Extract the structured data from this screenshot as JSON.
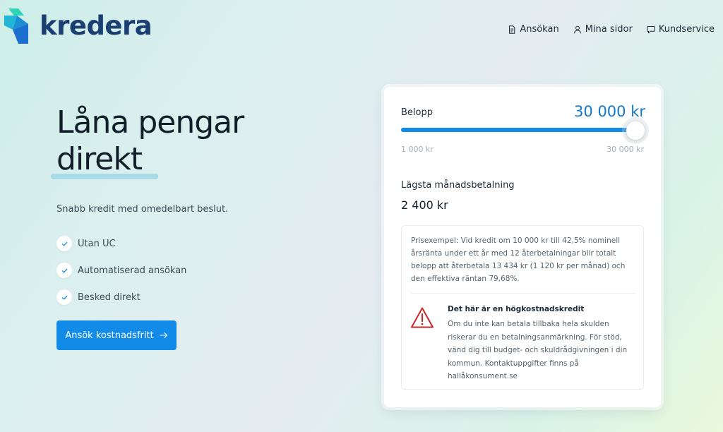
{
  "brand": {
    "name": "kredera"
  },
  "nav": [
    {
      "label": "Ansökan",
      "icon": "document-icon"
    },
    {
      "label": "Mina sidor",
      "icon": "user-icon"
    },
    {
      "label": "Kundservice",
      "icon": "chat-icon"
    }
  ],
  "hero": {
    "title_line1": "Låna pengar",
    "title_line2": "direkt",
    "subtitle": "Snabb kredit med omedelbart beslut.",
    "features": [
      "Utan UC",
      "Automatiserad ansökan",
      "Besked direkt"
    ],
    "cta_label": "Ansök kostnadsfritt"
  },
  "calculator": {
    "amount_label": "Belopp",
    "amount_value": "30 000 kr",
    "slider_min": "1 000 kr",
    "slider_max": "30 000 kr",
    "slider_fraction": 1.0,
    "lowest_payment_label": "Lägsta månadsbetalning",
    "lowest_payment_value": "2 400 kr",
    "price_example": "Prisexempel: Vid kredit om 10 000 kr till 42,5% nominell årsränta under ett år med 12 återbetalningar blir totalt belopp att återbetala 13 434 kr (1 120 kr per månad) och den effektiva räntan 79,68%.",
    "warning_title": "Det här är en högkostnadskredit",
    "warning_text": "Om du inte kan betala tillbaka hela skulden riskerar du en betalningsanmärkning. För stöd, vänd dig till budget- och skuldrådgivningen i din kommun. Kontaktuppgifter finns på hallåkonsument.se"
  },
  "colors": {
    "accent": "#128be8",
    "amount_text": "#1178cc",
    "brand_navy": "#1b3f73",
    "warning_red": "#c62828"
  }
}
